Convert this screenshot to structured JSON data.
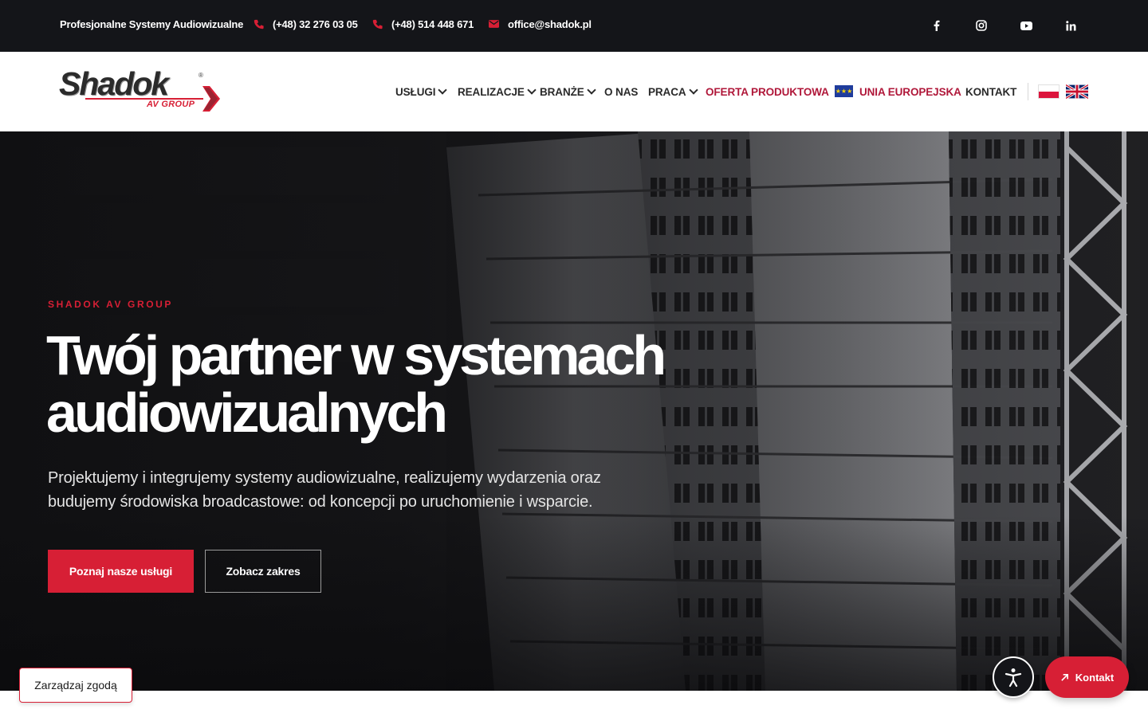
{
  "topbar": {
    "tagline": "Profesjonalne Systemy Audiowizualne",
    "phone1": "(+48) 32 276 03 05",
    "phone2": "(+48) 514 448 671",
    "email": "office@shadok.pl",
    "social": [
      "facebook-icon",
      "instagram-icon",
      "youtube-icon",
      "linkedin-icon"
    ]
  },
  "logo": {
    "word": "Shadok",
    "sub": "AV GROUP",
    "reg": "®"
  },
  "nav": {
    "uslugi": "USŁUGI",
    "realizacje": "REALIZACJE",
    "branze": "BRANŻE",
    "onas": "O NAS",
    "praca": "PRACA",
    "oferta": "OFERTA PRODUKTOWA",
    "unia": "UNIA EUROPEJSKA",
    "kontakt": "KONTAKT"
  },
  "languages": [
    "pl-flag",
    "uk-flag"
  ],
  "hero": {
    "eyebrow": "SHADOK AV GROUP",
    "title_line1": "Twój partner w systemach",
    "title_line2": "audiowizualnych",
    "lead_line1": "Projektujemy i integrujemy systemy audiowizualne, realizujemy wydarzenia oraz",
    "lead_line2": "budujemy środowiska broadcastowe: od koncepcji po uruchomienie i wsparcie.",
    "btn_primary": "Poznaj nasze usługi",
    "btn_secondary": "Zobacz zakres"
  },
  "floating": {
    "consent": "Zarządzaj zgodą",
    "kontakt": "Kontakt"
  },
  "colors": {
    "accent": "#d71f35",
    "nav_highlight": "#b0183a",
    "dark": "#141519"
  }
}
